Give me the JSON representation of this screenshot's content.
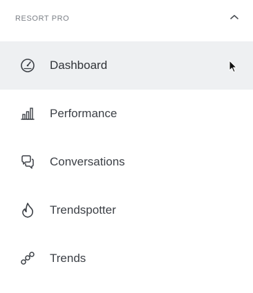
{
  "section": {
    "title": "RESORT PRO",
    "toggle_icon": "chevron-up-icon"
  },
  "nav": {
    "items": [
      {
        "label": "Dashboard",
        "icon": "speedometer-icon",
        "active": true
      },
      {
        "label": "Performance",
        "icon": "bar-chart-icon",
        "active": false
      },
      {
        "label": "Conversations",
        "icon": "chat-bubbles-icon",
        "active": false
      },
      {
        "label": "Trendspotter",
        "icon": "flame-icon",
        "active": false
      },
      {
        "label": "Trends",
        "icon": "trend-link-icon",
        "active": false
      }
    ]
  },
  "colors": {
    "active_background": "#eef0f2",
    "text": "#3b3f45",
    "muted": "#7b7f86"
  }
}
